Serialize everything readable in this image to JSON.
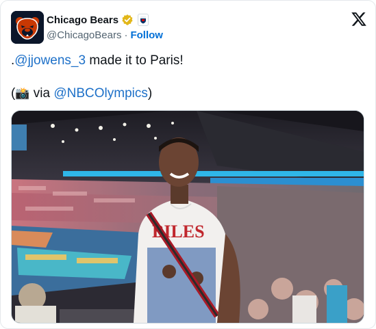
{
  "account": {
    "name": "Chicago Bears",
    "handle": "@ChicagoBears",
    "separator": "·",
    "follow_label": "Follow",
    "avatar_icon": "bears-logo-icon",
    "verified_icon": "verified-gold-badge-icon",
    "affiliate_icon": "nfl-shield-icon"
  },
  "platform_icon": "x-logo-icon",
  "tweet": {
    "line1": {
      "prefix": ".",
      "mention": "@jjowens_3",
      "rest": " made it to Paris!"
    },
    "line2": {
      "open": "(",
      "emoji": "📸",
      "via": " via ",
      "mention": "@NBCOlympics",
      "close": ")"
    }
  },
  "media": {
    "description_icon": "photo-icon",
    "shirt_text": "BILES"
  },
  "colors": {
    "link": "#1d70c8",
    "follow": "#006fd6",
    "muted": "#536471",
    "bears_navy": "#0b162a",
    "bears_orange": "#c83803"
  }
}
